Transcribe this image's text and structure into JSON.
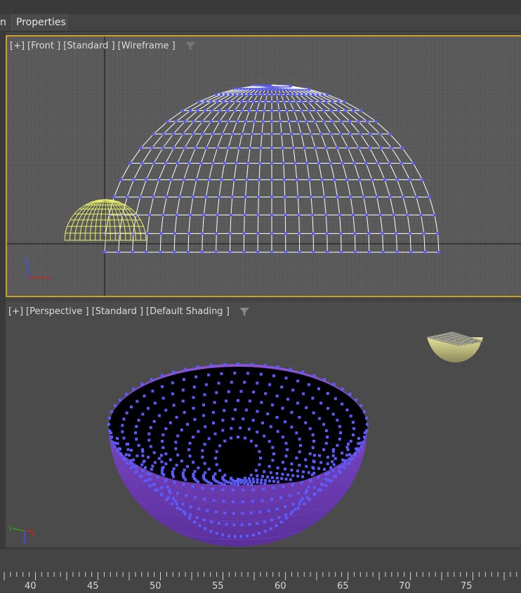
{
  "tabs": [
    {
      "label": "n"
    },
    {
      "label": "Properties"
    }
  ],
  "viewports": {
    "front": {
      "plus": "[+]",
      "view": "[Front ]",
      "preset": "[Standard ]",
      "mode": "[Wireframe ]"
    },
    "perspective": {
      "plus": "[+]",
      "view": "[Perspective ]",
      "preset": "[Standard ]",
      "mode": "[Default Shading ]"
    }
  },
  "axis_labels": {
    "z": "z",
    "x": "x",
    "y": "y"
  },
  "timeline_ruler": [
    "40",
    "45",
    "50",
    "55",
    "60",
    "65",
    "70",
    "75"
  ],
  "colors": {
    "active_border": "#c9a227",
    "wireframe_white": "#ffffff",
    "selected_wire": "#e8ef6a",
    "vertex_blue": "#5a5cff",
    "bowl_purple": "#7a47c4"
  }
}
